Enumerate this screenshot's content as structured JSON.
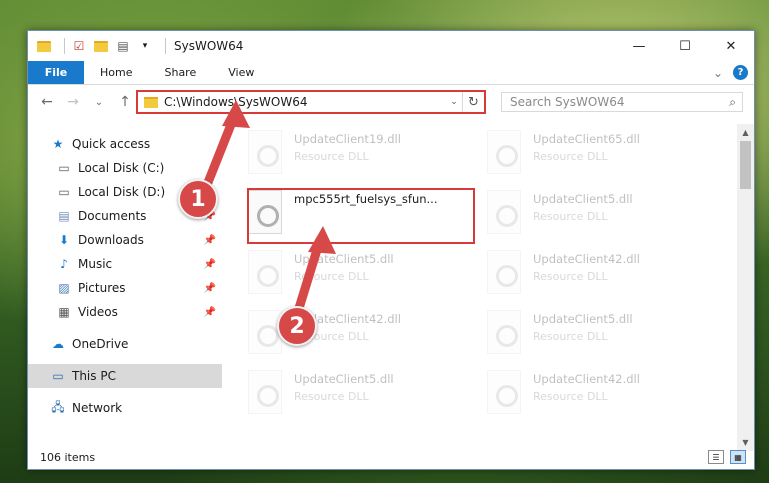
{
  "window": {
    "title": "SysWOW64"
  },
  "winbuttons": {
    "minimize": "—",
    "maximize": "☐",
    "close": "✕"
  },
  "ribbon": {
    "tabs": [
      "File",
      "Home",
      "Share",
      "View"
    ],
    "expand": "⌄",
    "help": "?"
  },
  "nav": {
    "back": "←",
    "forward": "→",
    "recent": "⌄",
    "up": "↑"
  },
  "address": {
    "path": "C:\\Windows\\SysWOW64",
    "dropdown": "⌄",
    "refresh": "↻"
  },
  "search": {
    "placeholder": "Search SysWOW64",
    "icon": "⌕"
  },
  "sidebar": {
    "quick_access": "Quick access",
    "items": [
      {
        "label": "Local Disk (C:)",
        "icon": "disk-icon",
        "pinned": false
      },
      {
        "label": "Local Disk (D:)",
        "icon": "disk-icon",
        "pinned": false
      },
      {
        "label": "Documents",
        "icon": "documents-icon",
        "pinned": true
      },
      {
        "label": "Downloads",
        "icon": "downloads-icon",
        "pinned": true
      },
      {
        "label": "Music",
        "icon": "music-icon",
        "pinned": true
      },
      {
        "label": "Pictures",
        "icon": "pictures-icon",
        "pinned": true
      },
      {
        "label": "Videos",
        "icon": "videos-icon",
        "pinned": true
      }
    ],
    "onedrive": "OneDrive",
    "thispc": "This PC",
    "network": "Network"
  },
  "files": {
    "col1": [
      {
        "name": "UpdateClient19.dll",
        "type": "Resource DLL"
      },
      {
        "name": "mpc555rt_fuelsys_sfun...",
        "type": ""
      },
      {
        "name": "UpdateClient5.dll",
        "type": "Resource DLL"
      },
      {
        "name": "UpdateClient42.dll",
        "type": "Resource DLL"
      },
      {
        "name": "UpdateClient5.dll",
        "type": "Resource DLL"
      }
    ],
    "col2": [
      {
        "name": "UpdateClient65.dll",
        "type": "Resource DLL"
      },
      {
        "name": "UpdateClient5.dll",
        "type": "Resource DLL"
      },
      {
        "name": "UpdateClient42.dll",
        "type": "Resource DLL"
      },
      {
        "name": "UpdateClient5.dll",
        "type": "Resource DLL"
      },
      {
        "name": "UpdateClient42.dll",
        "type": "Resource DLL"
      }
    ]
  },
  "status": {
    "count": "106 items"
  },
  "annotations": {
    "step1": "1",
    "step2": "2"
  },
  "colors": {
    "accent": "#1979ca",
    "highlight": "#d83a3a",
    "badge": "#d74848"
  }
}
